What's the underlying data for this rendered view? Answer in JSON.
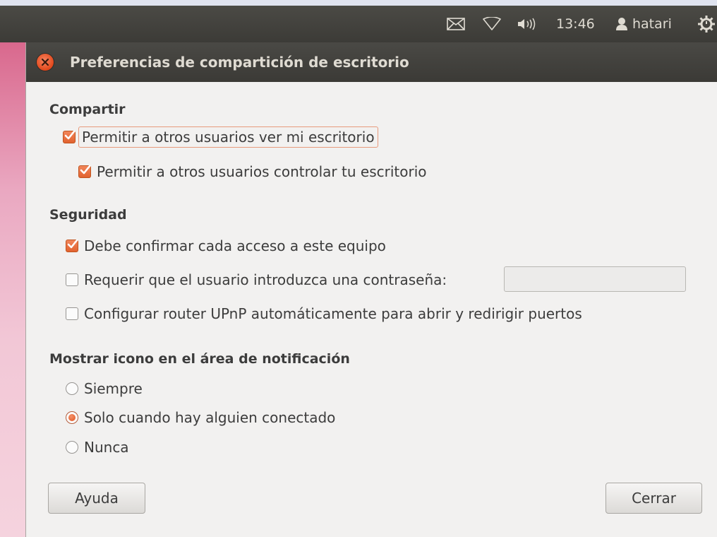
{
  "top_panel": {
    "clock": "13:46",
    "user": "hatari",
    "icons": [
      "mail-icon",
      "network-icon",
      "volume-icon",
      "user-icon",
      "power-gear-icon"
    ]
  },
  "window": {
    "title": "Preferencias de compartición de escritorio"
  },
  "sharing": {
    "heading": "Compartir",
    "allow_view": {
      "label": "Permitir a otros usuarios ver mi escritorio",
      "checked": true
    },
    "allow_control": {
      "label": "Permitir a otros usuarios controlar tu escritorio",
      "checked": true
    }
  },
  "security": {
    "heading": "Seguridad",
    "confirm_access": {
      "label": "Debe confirmar cada acceso a este equipo",
      "checked": true
    },
    "require_password": {
      "label": "Requerir que el usuario introduzca una contraseña:",
      "checked": false
    },
    "password_value": "",
    "upnp": {
      "label": "Configurar router UPnP automáticamente para abrir y redirigir puertos",
      "checked": false
    }
  },
  "notification": {
    "heading": "Mostrar icono en el área de notificación",
    "options": [
      {
        "label": "Siempre",
        "selected": false
      },
      {
        "label": "Solo cuando hay alguien conectado",
        "selected": true
      },
      {
        "label": "Nunca",
        "selected": false
      }
    ]
  },
  "buttons": {
    "help": "Ayuda",
    "close": "Cerrar"
  },
  "colors": {
    "accent": "#e2622f",
    "panel": "#3c3b37",
    "window_bg": "#f2f1f0"
  }
}
